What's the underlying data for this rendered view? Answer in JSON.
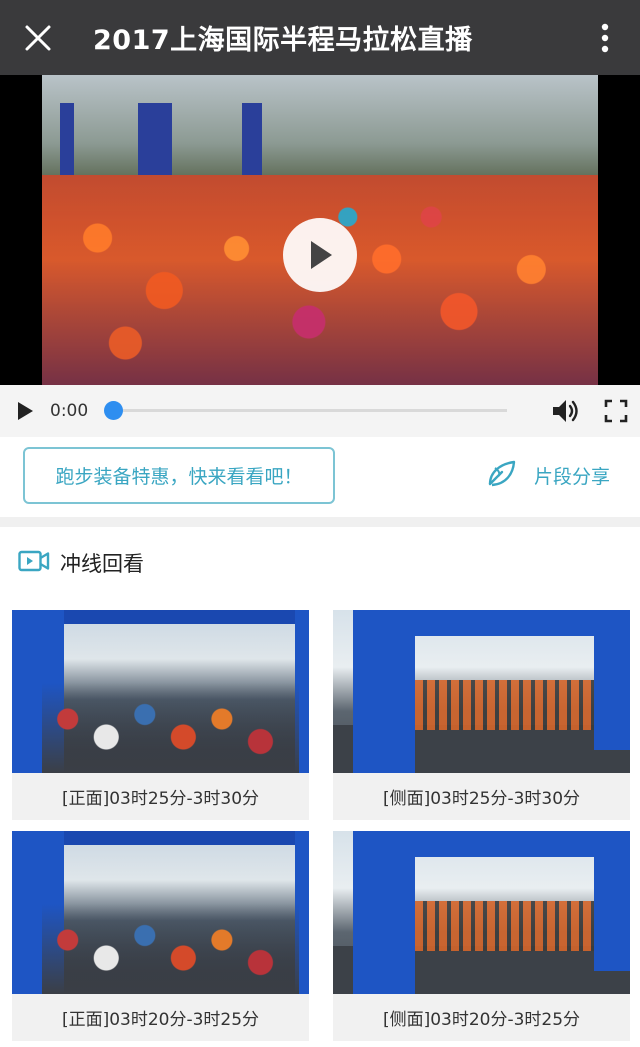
{
  "topbar": {
    "title": "2017上海国际半程马拉松直播",
    "close_icon": "close-icon",
    "more_icon": "more-vertical-icon"
  },
  "player": {
    "time": "0:00",
    "progress": 0.0,
    "play_icon": "play-icon",
    "volume_icon": "volume-icon",
    "fullscreen_icon": "fullscreen-icon"
  },
  "promo": {
    "button_label": "跑步装备特惠，快来看看吧！",
    "share_label": "片段分享",
    "share_icon": "share-icon"
  },
  "section": {
    "title": "冲线回看",
    "icon": "video-icon"
  },
  "clips": [
    {
      "label": "[正面]03时25分-3时30分"
    },
    {
      "label": "[侧面]03时25分-3时30分"
    },
    {
      "label": "[正面]03时20分-3时25分"
    },
    {
      "label": "[侧面]03时20分-3时25分"
    }
  ],
  "colors": {
    "topbar_bg": "#3a3a3c",
    "accent": "#3aa6c2",
    "progress_knob": "#2e8ef0"
  }
}
